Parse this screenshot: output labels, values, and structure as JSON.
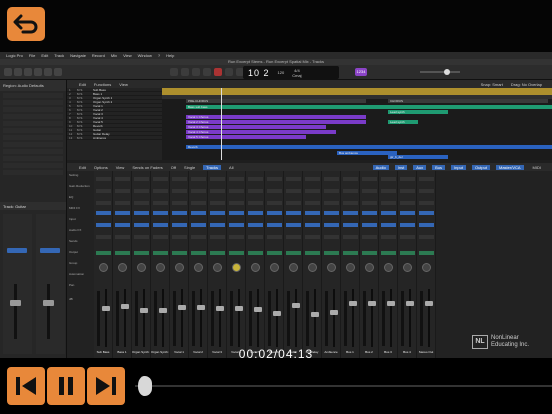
{
  "video": {
    "timecode": "00:02/04:13",
    "progress": 0.008,
    "buttons": [
      "back",
      "rewind",
      "pause",
      "fast-forward"
    ]
  },
  "menubar": {
    "items": [
      "Logic Pro",
      "File",
      "Edit",
      "Track",
      "Navigate",
      "Record",
      "Mix",
      "View",
      "Window",
      "?",
      "Help"
    ]
  },
  "window": {
    "title": "Run Excerpt Stems - Run Excerpt Spatial Mix - Tracks"
  },
  "lcd": {
    "position": "10 2",
    "tempo": "120",
    "signature": "4/4",
    "key": "Cmaj",
    "badge": "1234"
  },
  "inspector": {
    "header": "Region: Audio Defaults",
    "track_label": "Track: Guitar"
  },
  "tracks_toolbar": {
    "left": [
      "Edit",
      "Functions",
      "View"
    ],
    "right": [
      "Snap: Smart",
      "Drag: No Overlap"
    ]
  },
  "tracks": [
    {
      "num": "1",
      "name": "Sub Bass"
    },
    {
      "num": "2",
      "name": "Bass 1"
    },
    {
      "num": "3",
      "name": "Organ Synth 1"
    },
    {
      "num": "4",
      "name": "Organ Synth 2"
    },
    {
      "num": "5",
      "name": "Vocal 1"
    },
    {
      "num": "6",
      "name": "Vocal 2"
    },
    {
      "num": "7",
      "name": "Vocal 3"
    },
    {
      "num": "8",
      "name": "Vocal 4"
    },
    {
      "num": "9",
      "name": "Vocal 5"
    },
    {
      "num": "10",
      "name": "Reverb"
    },
    {
      "num": "11",
      "name": "Guitar"
    },
    {
      "num": "12",
      "name": "Guitar Delay"
    },
    {
      "num": "13",
      "name": "Ambience"
    }
  ],
  "timeline": {
    "markers": [
      "PRE-CHORUS",
      "CHORUS"
    ],
    "regions": [
      "Bass sub bass",
      "Vocal 1 Chorus",
      "Vocal 2 Chorus",
      "Vocal 3 Chorus",
      "Vocal 4 Chorus",
      "Vocal 5 Chorus",
      "Lead synth",
      "Reverb",
      "Bus ambience",
      "gtr_b_del"
    ]
  },
  "mixer_toolbar": {
    "left": [
      "Edit",
      "Options",
      "View",
      "Sends on Faders",
      "Off"
    ],
    "modes": [
      "Single",
      "Tracks",
      "All"
    ],
    "filters": [
      "Audio",
      "Inst",
      "Aux",
      "Bus",
      "Input",
      "Output",
      "Master/VCA",
      "MIDI"
    ]
  },
  "mixer": {
    "row_labels": [
      "Setting",
      "Gain Reduction",
      "EQ",
      "MIDI FX",
      "Input",
      "Audio FX",
      "Sends",
      "Output",
      "Group",
      "Automation",
      "Pan",
      "dB"
    ],
    "strips": [
      {
        "name": "Sub Bass",
        "db": "-4.5"
      },
      {
        "name": "Bass 1",
        "db": "-2.1"
      },
      {
        "name": "Organ Synth 1",
        "db": "-6.0"
      },
      {
        "name": "Organ Synth 2",
        "db": "-6.0"
      },
      {
        "name": "Vocal 1",
        "db": "-3.2"
      },
      {
        "name": "Vocal 2",
        "db": "-3.5"
      },
      {
        "name": "Vocal 3",
        "db": "-4.0"
      },
      {
        "name": "Vocal 4",
        "db": "-4.1"
      },
      {
        "name": "Vocal 5",
        "db": "-5.0"
      },
      {
        "name": "Reverb",
        "db": "-8.0"
      },
      {
        "name": "Guitar",
        "db": "-2.0"
      },
      {
        "name": "Gtr Delay",
        "db": "-9.0"
      },
      {
        "name": "Ambience",
        "db": "-7.5"
      },
      {
        "name": "Bus 1",
        "db": "0.0"
      },
      {
        "name": "Bus 2",
        "db": "0.0"
      },
      {
        "name": "Bus 3",
        "db": "0.0"
      },
      {
        "name": "Bus 4",
        "db": "0.0"
      },
      {
        "name": "Stereo Out",
        "db": "0.0"
      }
    ]
  },
  "watermark": {
    "logo": "NL",
    "line1": "NonLinear",
    "line2": "Educating Inc."
  },
  "colors": {
    "accent": "#e8883a",
    "ruler": "#ad8f2d",
    "region_green": "#1f9b72",
    "region_purple": "#7a3bc8",
    "selection_blue": "#3467b5"
  }
}
